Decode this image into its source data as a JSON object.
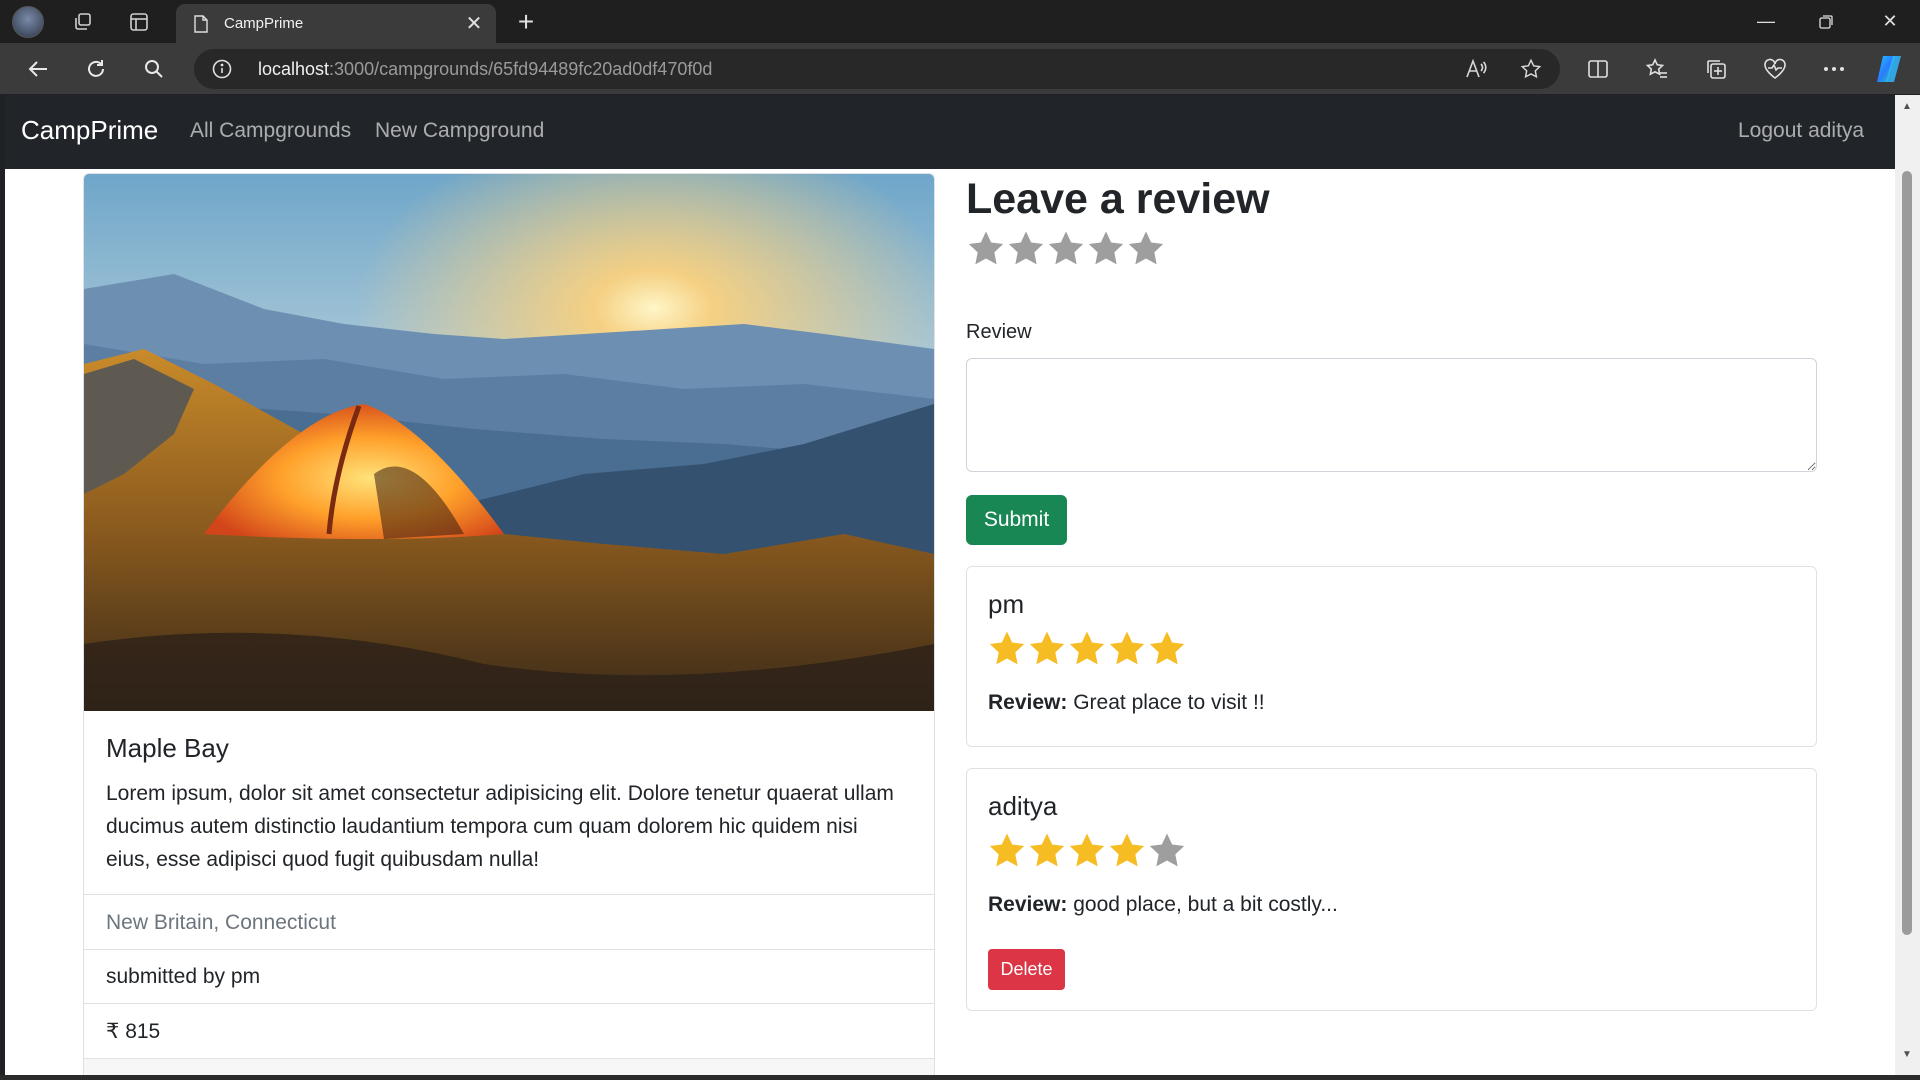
{
  "browser": {
    "tab_title": "CampPrime",
    "url_host": "localhost",
    "url_path": ":3000/campgrounds/65fd94489fc20ad0df470f0d",
    "icons": [
      "profile-icon",
      "workspaces-icon",
      "tab-actions-icon",
      "page-icon",
      "close-icon",
      "new-tab-icon",
      "minimize-icon",
      "restore-icon",
      "close-window-icon",
      "back-icon",
      "refresh-icon",
      "search-icon",
      "info-icon",
      "read-aloud-icon",
      "favorite-star-icon",
      "split-screen-icon",
      "favorites-icon",
      "collections-icon",
      "browser-essentials-icon",
      "more-icon",
      "copilot-icon"
    ]
  },
  "navbar": {
    "brand": "CampPrime",
    "links": [
      "All Campgrounds",
      "New Campground"
    ],
    "logout": "Logout aditya"
  },
  "campground": {
    "title": "Maple Bay",
    "description": "Lorem ipsum, dolor sit amet consectetur adipisicing elit. Dolore tenetur quaerat ullam ducimus autem distinctio laudantium tempora cum quam dolorem hic quidem nisi eius, esse adipisci quod fugit quibusdam nulla!",
    "location": "New Britain, Connecticut",
    "submitted_by": "submitted by pm",
    "price": "₹ 815"
  },
  "review_form": {
    "heading": "Leave a review",
    "rating": 0,
    "label": "Review",
    "value": "",
    "submit_label": "Submit"
  },
  "reviews": [
    {
      "author": "pm",
      "rating": 5,
      "label": "Review:",
      "text": "Great place to visit !!"
    },
    {
      "author": "aditya",
      "rating": 4,
      "label": "Review:",
      "text": "good place, but a bit costly...",
      "delete_label": "Delete"
    }
  ],
  "colors": {
    "star_filled": "#f5bd23",
    "star_empty": "#9e9e9e",
    "success": "#198754",
    "danger": "#dc3545",
    "navbar": "#212529"
  }
}
